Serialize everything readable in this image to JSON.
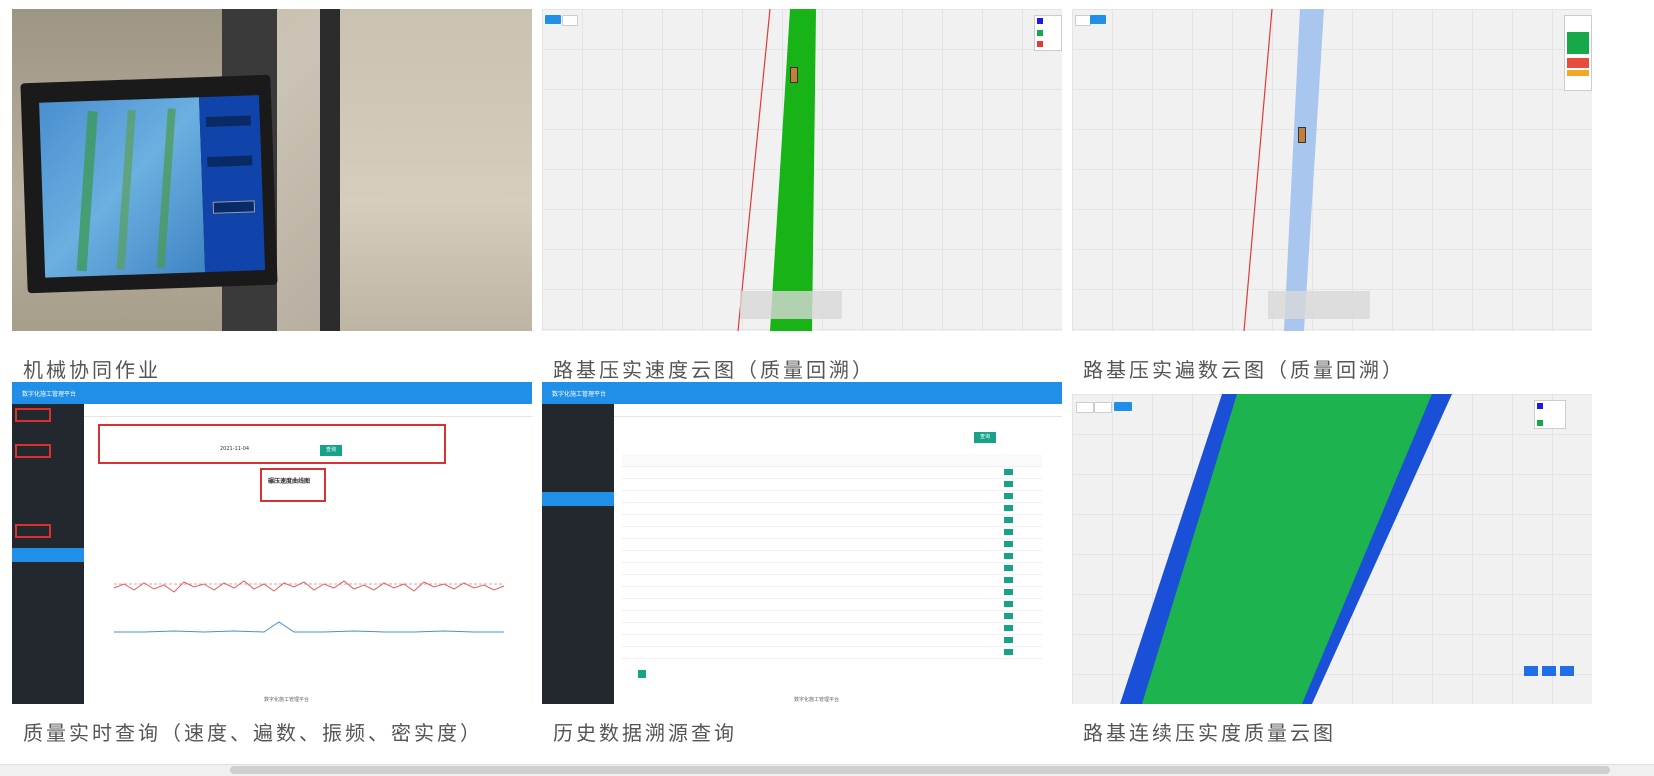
{
  "cards": [
    {
      "caption": "机械协同作业"
    },
    {
      "caption": "路基压实速度云图（质量回溯）"
    },
    {
      "caption": "路基压实遍数云图（质量回溯）"
    },
    {
      "caption": "质量实时查询（速度、遍数、振频、密实度）"
    },
    {
      "caption": "历史数据溯源查询"
    },
    {
      "caption": "路基连续压实度质量云图"
    }
  ],
  "colors": {
    "accent": "#1f8fe8",
    "green": "#17a84a",
    "red": "#d93030",
    "teal": "#16a38a"
  },
  "dashboard": {
    "platform_name": "数字化施工管理平台",
    "footer": "数字化施工管理平台",
    "query_button": "查询",
    "date_value": "2021-11-04",
    "chart_title": "碾压速度曲线图"
  }
}
